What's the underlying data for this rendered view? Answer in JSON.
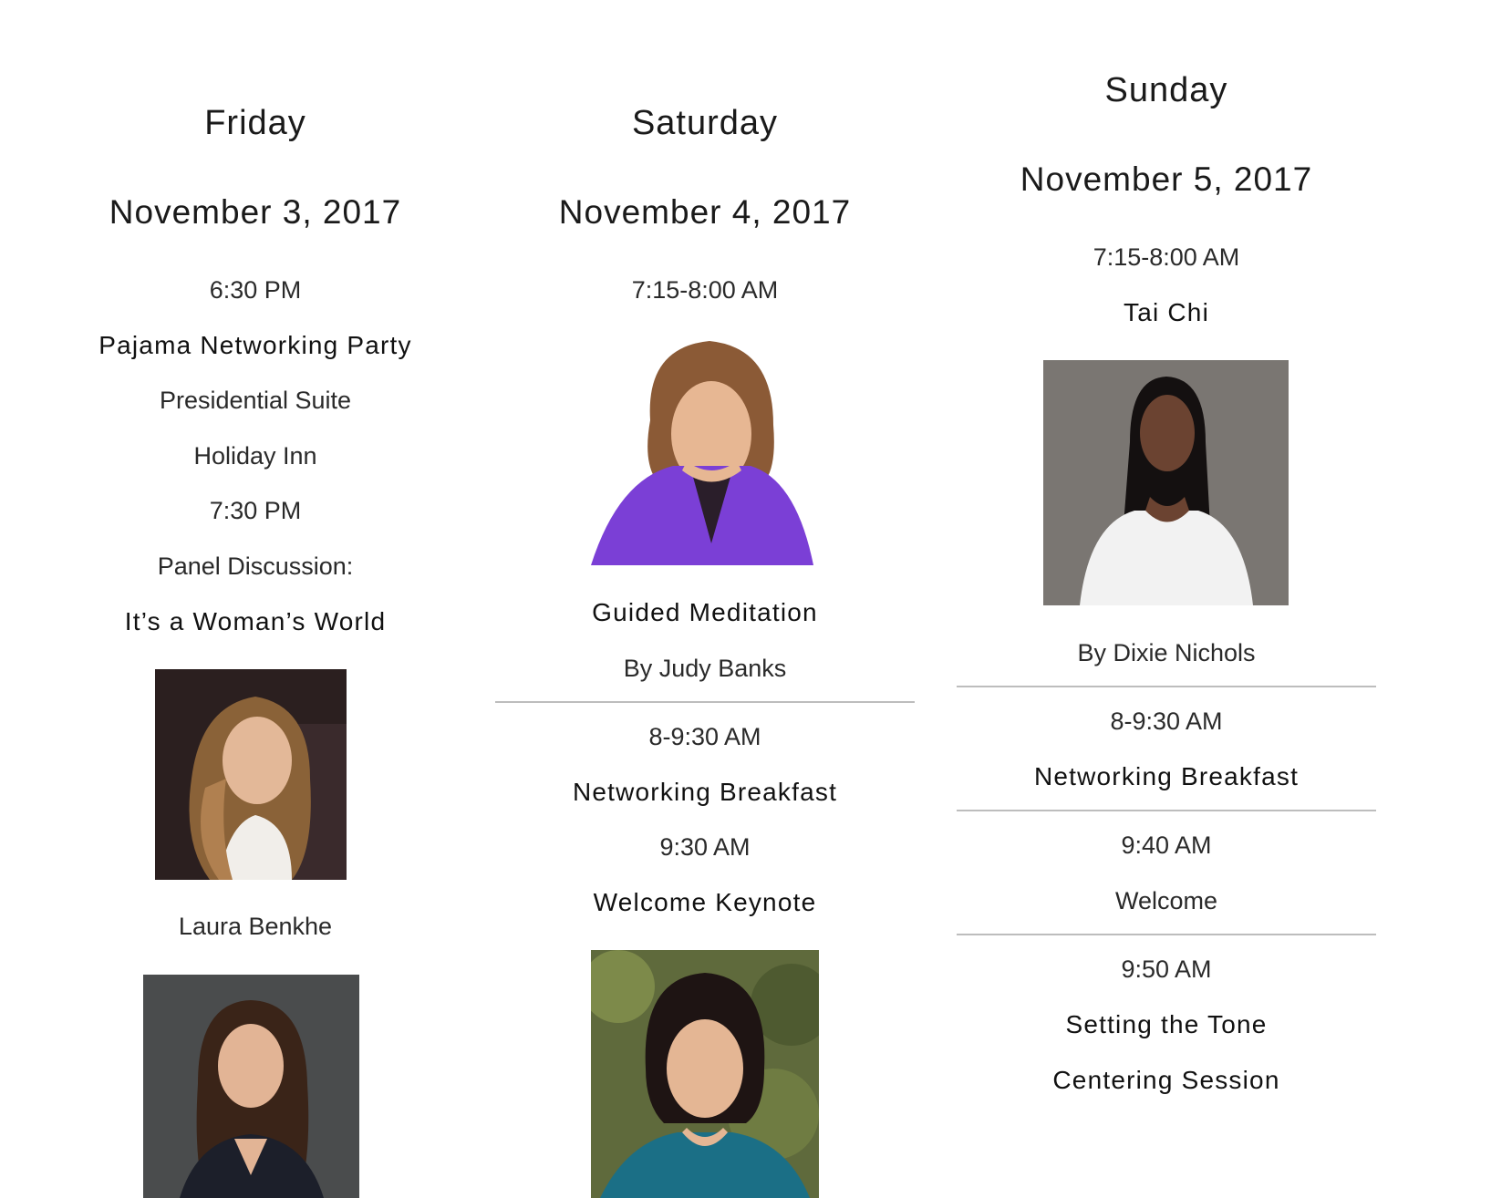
{
  "friday": {
    "day": "Friday",
    "date": "November 3, 2017",
    "time1": "6:30 PM",
    "event1": "Pajama Networking Party",
    "location1": "Presidential Suite",
    "location2": "Holiday Inn",
    "time2": "7:30 PM",
    "panel_label": "Panel Discussion:",
    "panel_title": "It’s a Woman’s World",
    "speaker1": "Laura Benkhe"
  },
  "saturday": {
    "day": "Saturday",
    "date": "November 4, 2017",
    "time1": "7:15-8:00 AM",
    "event1": "Guided Meditation",
    "by1": "By Judy Banks",
    "time2": "8-9:30 AM",
    "event2": "Networking Breakfast",
    "time3": "9:30 AM",
    "event3": "Welcome Keynote"
  },
  "sunday": {
    "day": "Sunday",
    "date": "November 5, 2017",
    "time1": "7:15-8:00 AM",
    "event1": "Tai Chi",
    "by1": "By Dixie Nichols",
    "time2": "8-9:30 AM",
    "event2": "Networking Breakfast",
    "time3": "9:40 AM",
    "event3": "Welcome",
    "time4": "9:50 AM",
    "event4a": "Setting the Tone",
    "event4b": "Centering Session"
  },
  "colors": {
    "text": "#1f1f1f",
    "rule": "#bdbdbd",
    "purple_top": "#7b3fd6",
    "white_top": "#f2f2f2",
    "teal_top": "#1b6f86"
  }
}
